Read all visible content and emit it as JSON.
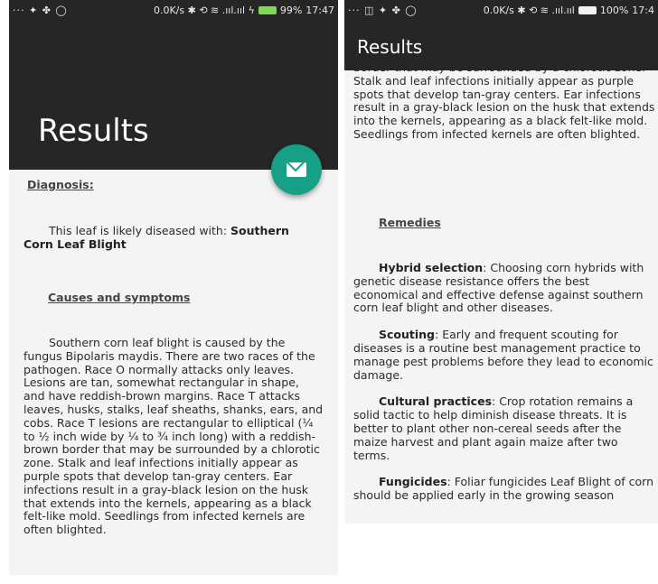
{
  "left": {
    "status": {
      "left_icons": "··· ✦ ✤ ◯",
      "net": "0.0K/s ✱ ⟲ ≋ .ııl.ııl ϟ",
      "battery": "99%",
      "time": "17:47"
    },
    "title": "Results",
    "diagnosis_heading": "Diagnosis:",
    "diagnosis_prefix": "This leaf is likely diseased with: ",
    "diagnosis_value": "Southern Corn Leaf Blight",
    "causes_heading": "Causes and symptoms",
    "causes_text": "Southern corn leaf blight is caused by the fungus Bipolaris maydis. There are two races of the pathogen. Race O normally attacks only leaves. Lesions are tan, somewhat rectangular in shape, and have reddish-brown margins. Race T attacks leaves, husks, stalks, leaf sheaths, shanks, ears, and cobs. Race T lesions are rectangular to elliptical (¼ to ½ inch wide by ¼ to ¾ inch long) with a reddish-brown border that may be surrounded by a chlorotic zone. Stalk and leaf infections initially appear as purple spots that develop tan-gray centers. Ear infections result in a gray-black lesion on the husk that extends into the kernels, appearing as a black felt-like mold. Seedlings from infected kernels are often blighted."
  },
  "right": {
    "status": {
      "left_icons": "··· ◫ ✦ ✤ ◯",
      "net": "0.0K/s ✱ ⟲ ≋ .ııl.ııl",
      "battery": "100%",
      "time": "17:4"
    },
    "title": "Results",
    "scrolled_text": "border that may be surrounded by a chlorotic zone. Stalk and leaf infections initially appear as purple spots that develop tan-gray centers. Ear infections result in a gray-black lesion on the husk that extends into the kernels, appearing as a black felt-like mold. Seedlings from infected kernels are often blighted.",
    "remedies_heading": "Remedies",
    "remedies": [
      {
        "title": "Hybrid selection",
        "text": ": Choosing corn hybrids with genetic disease resistance offers the best economical and effective defense against southern corn leaf blight and other diseases."
      },
      {
        "title": "Scouting",
        "text": ": Early and frequent scouting for diseases is a routine best management practice to manage pest problems before they lead to economic damage."
      },
      {
        "title": "Cultural practices",
        "text": ": Crop rotation remains a solid tactic to help diminish disease threats. It is better to plant other non-cereal seeds after the maize harvest and plant again maize after two terms."
      },
      {
        "title": "Fungicides",
        "text": ": Foliar fungicides Leaf Blight of corn should be applied early in the growing season"
      }
    ]
  },
  "colors": {
    "appbar": "#262626",
    "fab": "#16a085",
    "background": "#f4f4f4"
  },
  "icons": {
    "fab": "envelope-icon"
  }
}
